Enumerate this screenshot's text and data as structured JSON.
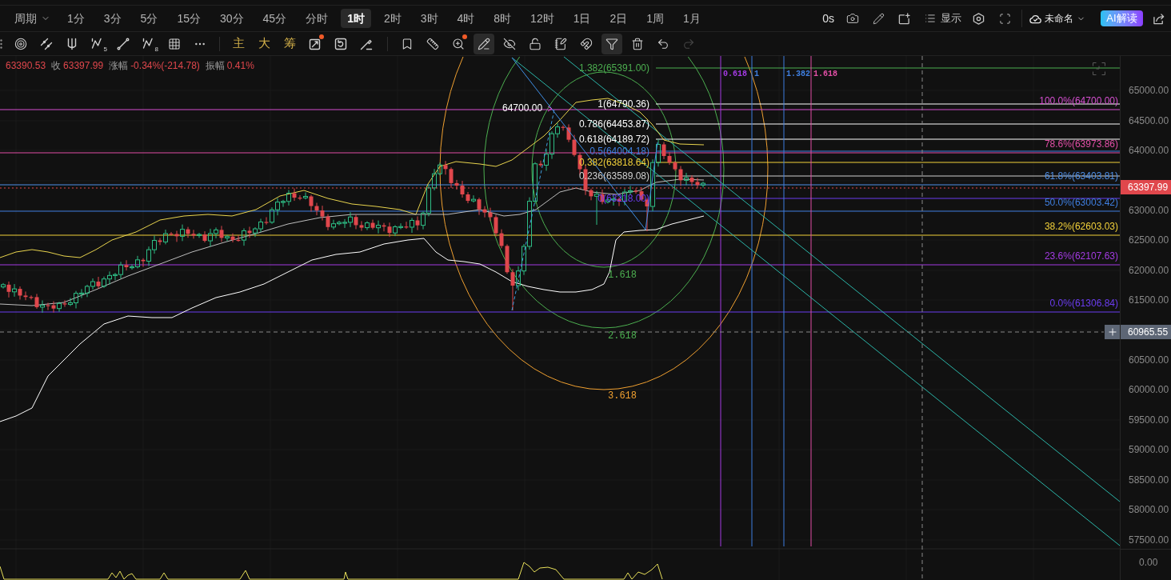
{
  "toolbar": {
    "period": {
      "label": "周期"
    },
    "intervals": [
      {
        "label": "1分",
        "selected": false
      },
      {
        "label": "3分",
        "selected": false
      },
      {
        "label": "5分",
        "selected": false
      },
      {
        "label": "15分",
        "selected": false
      },
      {
        "label": "30分",
        "selected": false
      },
      {
        "label": "45分",
        "selected": false
      },
      {
        "label": "分时",
        "selected": false
      },
      {
        "label": "1时",
        "selected": true
      },
      {
        "label": "2时",
        "selected": false
      },
      {
        "label": "3时",
        "selected": false
      },
      {
        "label": "4时",
        "selected": false
      },
      {
        "label": "8时",
        "selected": false
      },
      {
        "label": "12时",
        "selected": false
      },
      {
        "label": "1日",
        "selected": false
      },
      {
        "label": "2日",
        "selected": false
      },
      {
        "label": "1周",
        "selected": false
      },
      {
        "label": "1月",
        "selected": false
      }
    ],
    "countdown": "0s",
    "display": {
      "label": "显示"
    },
    "layout": {
      "label": "未命名"
    },
    "ai": {
      "label": "AI解读"
    }
  },
  "tool_groups": [
    [
      {
        "kind": "target",
        "on": false,
        "dot": false,
        "disabled": false
      },
      {
        "kind": "parallel",
        "on": false,
        "dot": false,
        "disabled": false
      },
      {
        "kind": "pitchfork",
        "on": false,
        "dot": false,
        "disabled": false
      },
      {
        "kind": "wave",
        "label": "5",
        "on": false,
        "dot": false,
        "disabled": false
      },
      {
        "kind": "segment",
        "on": false,
        "dot": false,
        "disabled": false
      },
      {
        "kind": "wave",
        "label": "8",
        "on": false,
        "dot": false,
        "disabled": false
      },
      {
        "kind": "grid",
        "on": false,
        "dot": false,
        "disabled": false
      },
      {
        "kind": "more",
        "on": false,
        "dot": false,
        "disabled": false
      }
    ],
    [
      {
        "kind": "text",
        "label": "主",
        "on": false,
        "dot": false,
        "disabled": false
      },
      {
        "kind": "text",
        "label": "大",
        "on": false,
        "dot": false,
        "disabled": false
      },
      {
        "kind": "text",
        "label": "筹",
        "on": false,
        "dot": false,
        "disabled": false
      },
      {
        "kind": "diagonal",
        "on": false,
        "dot": true,
        "disabled": false
      },
      {
        "kind": "rotate",
        "on": false,
        "dot": false,
        "disabled": false
      },
      {
        "kind": "brush",
        "on": false,
        "dot": false,
        "disabled": false
      }
    ],
    [
      {
        "kind": "bookmark",
        "on": false,
        "dot": false,
        "disabled": false
      },
      {
        "kind": "ruler",
        "on": false,
        "dot": false,
        "disabled": false
      },
      {
        "kind": "zoom",
        "on": false,
        "dot": true,
        "disabled": false
      },
      {
        "kind": "pencil",
        "on": true,
        "dot": false,
        "disabled": false
      },
      {
        "kind": "hide",
        "on": false,
        "dot": false,
        "disabled": false
      },
      {
        "kind": "unlock",
        "on": false,
        "dot": false,
        "disabled": false
      },
      {
        "kind": "note",
        "on": false,
        "dot": false,
        "disabled": false
      },
      {
        "kind": "magnet",
        "on": false,
        "dot": false,
        "disabled": false
      },
      {
        "kind": "filter",
        "on": true,
        "dot": false,
        "disabled": false
      },
      {
        "kind": "trash",
        "on": false,
        "dot": false,
        "disabled": false
      },
      {
        "kind": "undo",
        "on": false,
        "dot": false,
        "disabled": false
      },
      {
        "kind": "redo",
        "on": false,
        "dot": false,
        "disabled": true
      }
    ]
  ],
  "chart": {
    "info": [
      {
        "value": "63390.53"
      },
      {
        "label": "收",
        "value": "63397.99"
      },
      {
        "label": "涨幅",
        "value": "-0.34%(-214.78)"
      },
      {
        "label": "振幅",
        "value": "0.41%"
      }
    ],
    "high_marker": "64700.00",
    "fib_extension": [
      {
        "label": "1.382(65391.00)",
        "color": "#4caf50"
      },
      {
        "label": "1(64790.36)",
        "color": "#ffffff"
      },
      {
        "label": "0.786(64453.87)",
        "color": "#ffffff"
      },
      {
        "label": "0.618(64189.72)",
        "color": "#ffffff"
      },
      {
        "label": "0.5(64004.18)",
        "color": "#3f7fe0"
      },
      {
        "label": "0.382(63818.64)",
        "color": "#f2d13a"
      },
      {
        "label": "0.236(63589.08)",
        "color": "#d0d0d0"
      },
      {
        "label": "0(63218.00)",
        "color": "#6b3cf0"
      }
    ],
    "fib_circles": [
      {
        "label": "1.618",
        "color": "#4caf50"
      },
      {
        "label": "2.618",
        "color": "#4caf50"
      },
      {
        "label": "3.618",
        "color": "#f0a030"
      }
    ],
    "time_zones": [
      {
        "label": "0.618",
        "color": "#a43be3"
      },
      {
        "label": "1",
        "color": "#3f7fe0"
      },
      {
        "label": "1.382",
        "color": "#3f7fe0"
      },
      {
        "label": "1.618",
        "color": "#e24fa6"
      }
    ],
    "fib_retracement": [
      {
        "label": "100.0%(64700.00)",
        "color": "#d54fd0"
      },
      {
        "label": "78.6%(63973.86)",
        "color": "#e24fa6"
      },
      {
        "label": "61.8%(63403.81)",
        "color": "#4f8fe6"
      },
      {
        "label": "50.0%(63003.42)",
        "color": "#3f7fe0"
      },
      {
        "label": "38.2%(62603.03)",
        "color": "#f2d13a"
      },
      {
        "label": "23.6%(62107.63)",
        "color": "#a43be3"
      },
      {
        "label": "0.0%(61306.84)",
        "color": "#6b3cf0"
      }
    ]
  },
  "price_axis": {
    "ticks": [
      "65000.00",
      "64500.00",
      "64000.00",
      "63000.00",
      "62500.00",
      "62000.00",
      "61500.00",
      "60500.00",
      "60000.00",
      "59500.00",
      "59000.00",
      "58500.00",
      "58000.00",
      "57500.00"
    ],
    "last_price": "63397.99",
    "crosshair_price": "60965.55",
    "indicator_ticks": [
      "0.00"
    ]
  }
}
